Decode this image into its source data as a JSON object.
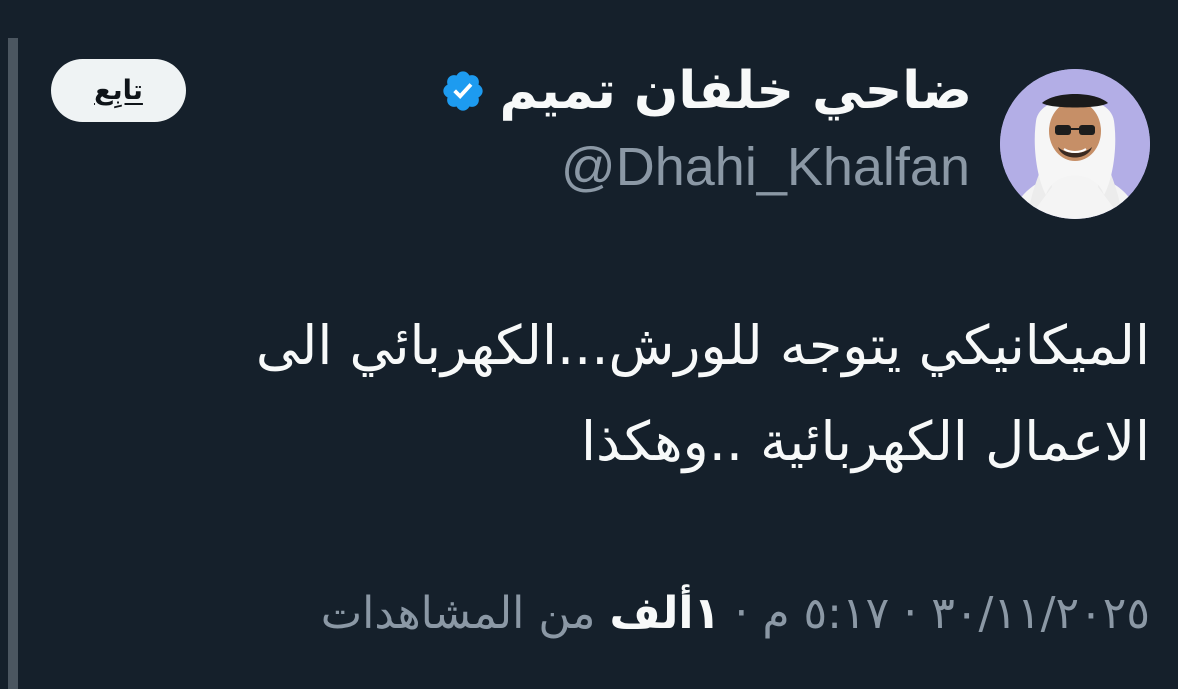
{
  "author": {
    "display_name": "ضاحي خلفان تميم",
    "handle": "@Dhahi_Khalfan",
    "verified_icon": "verified-badge-icon",
    "verified_color": "#1d9bf0"
  },
  "follow_button": {
    "label": "تابِع"
  },
  "tweet": {
    "text_line_1": "الميكانيكي يتوجه للورش...الكهربائي الى",
    "text_line_2": "الاعمال الكهربائية ..وهكذا"
  },
  "meta": {
    "date": "٣٠/١١/٢٠٢٥",
    "separator": "·",
    "time": "٥:١٧ م",
    "views_count": "١ألف",
    "views_label": "من المشاهدات"
  },
  "colors": {
    "background": "#15202b",
    "text_primary": "#f7f9f9",
    "text_secondary": "#8b98a5",
    "button_bg": "#eff3f4"
  }
}
